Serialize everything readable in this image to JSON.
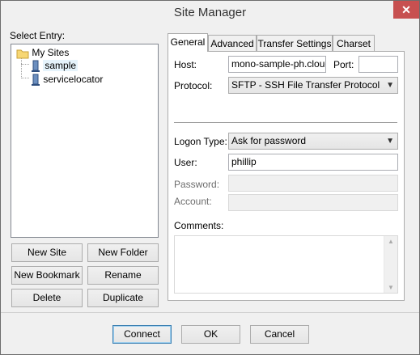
{
  "window": {
    "title": "Site Manager",
    "close_glyph": "✕"
  },
  "left": {
    "select_entry_label": "Select Entry:",
    "tree": {
      "root": "My Sites",
      "items": [
        "sample",
        "servicelocator"
      ]
    },
    "buttons": {
      "new_site": "New Site",
      "new_folder": "New Folder",
      "new_bookmark": "New Bookmark",
      "rename": "Rename",
      "delete": "Delete",
      "duplicate": "Duplicate"
    }
  },
  "tabs": [
    "General",
    "Advanced",
    "Transfer Settings",
    "Charset"
  ],
  "general": {
    "host_label": "Host:",
    "host_value": "mono-sample-ph.cloudapp.net",
    "port_label": "Port:",
    "port_value": "",
    "protocol_label": "Protocol:",
    "protocol_value": "SFTP - SSH File Transfer Protocol",
    "logon_label": "Logon Type:",
    "logon_value": "Ask for password",
    "user_label": "User:",
    "user_value": "phillip",
    "password_label": "Password:",
    "account_label": "Account:",
    "comments_label": "Comments:"
  },
  "footer": {
    "connect": "Connect",
    "ok": "OK",
    "cancel": "Cancel"
  },
  "icons": {
    "dropdown": "chevron-down-icon",
    "folder": "folder-icon",
    "server": "server-icon"
  }
}
